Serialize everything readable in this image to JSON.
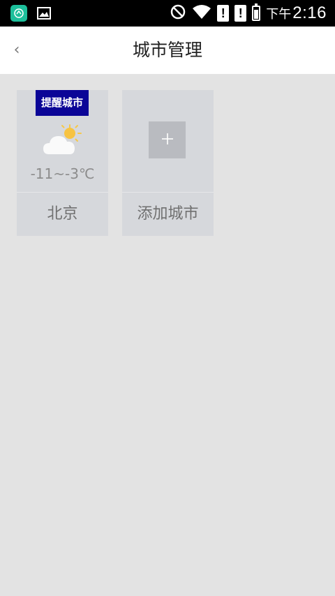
{
  "status_bar": {
    "ampm": "下午",
    "time": "2:16",
    "warn1": "!",
    "warn2": "!",
    "battery_level": 0.85
  },
  "header": {
    "back_icon": "‹",
    "title": "城市管理"
  },
  "cities": [
    {
      "badge": "提醒城市",
      "weather_icon": "partly-cloudy-icon",
      "temp": "-11~-3℃",
      "name": "北京"
    }
  ],
  "add_city": {
    "label": "添加城市",
    "icon": "plus-icon"
  }
}
